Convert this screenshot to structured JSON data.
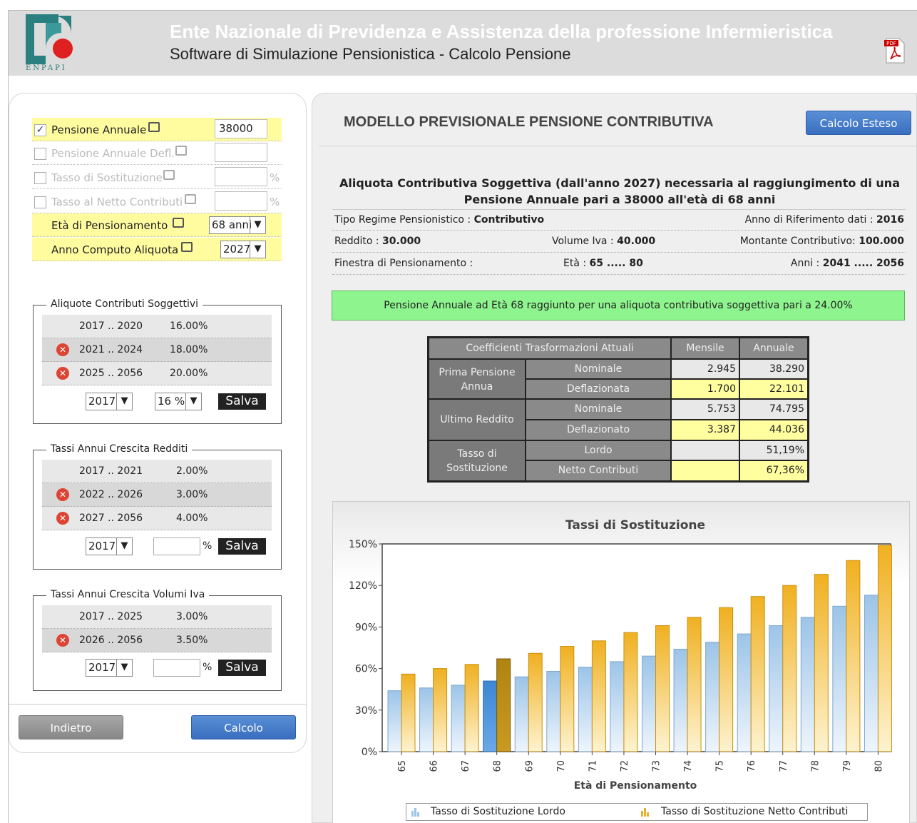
{
  "header": {
    "logo_text": "ENPAPI",
    "title": "Ente Nazionale di Previdenza e Assistenza della professione Infermieristica",
    "subtitle": "Software di Simulazione Pensionistica - Calcolo Pensione",
    "pdf_label": "PDF"
  },
  "form": {
    "pensione_annuale": {
      "label": "Pensione Annuale",
      "checked": true,
      "value": "38000"
    },
    "pensione_defl": {
      "label": "Pensione Annuale Defl."
    },
    "tasso_sost": {
      "label": "Tasso di Sostituzione",
      "unit": "%"
    },
    "tasso_netto": {
      "label": "Tasso al Netto Contributi",
      "unit": "%"
    },
    "eta_pens": {
      "label": "Età di Pensionamento",
      "value": "68 anni"
    },
    "anno_computo": {
      "label": "Anno Computo Aliquota",
      "value": "2027"
    }
  },
  "aliquote": {
    "legend": "Aliquote Contributi Soggettivi",
    "rows": [
      {
        "range": "2017 .. 2020",
        "value": "16.00%"
      },
      {
        "range": "2021 .. 2024",
        "value": "18.00%"
      },
      {
        "range": "2025 .. 2056",
        "value": "20.00%"
      }
    ],
    "year_sel": "2017",
    "pct_sel": "16 %",
    "save": "Salva"
  },
  "redditi": {
    "legend": "Tassi Annui Crescita Redditi",
    "rows": [
      {
        "range": "2017 .. 2021",
        "value": "2.00%"
      },
      {
        "range": "2022 .. 2026",
        "value": "3.00%"
      },
      {
        "range": "2027 .. 2056",
        "value": "4.00%"
      }
    ],
    "year_sel": "2017",
    "unit": "%",
    "save": "Salva"
  },
  "iva": {
    "legend": "Tassi Annui Crescita Volumi Iva",
    "rows": [
      {
        "range": "2017 .. 2025",
        "value": "3.00%"
      },
      {
        "range": "2026 .. 2056",
        "value": "3.50%"
      }
    ],
    "year_sel": "2017",
    "unit": "%",
    "save": "Salva"
  },
  "buttons": {
    "back": "Indietro",
    "calc": "Calcolo",
    "extended": "Calcolo Esteso"
  },
  "right": {
    "title": "MODELLO PREVISIONALE PENSIONE CONTRIBUTIVA",
    "info_title": "Aliquota Contributiva Soggettiva (dall'anno 2027) necessaria al raggiungimento di una Pensione Annuale pari a 38000 all'età di 68 anni",
    "regime_label": "Tipo Regime Pensionistico : ",
    "regime_value": "Contributivo",
    "anno_rif_label": "Anno di Riferimento dati : ",
    "anno_rif_value": "2016",
    "reddito_label": "Reddito : ",
    "reddito_value": "30.000",
    "iva_label": "Volume Iva : ",
    "iva_value": "40.000",
    "montante_label": "Montante Contributivo: ",
    "montante_value": "100.000",
    "finestra_label": "Finestra di Pensionamento :",
    "eta_label": "Età : ",
    "eta_value": "65 ..... 80",
    "anni_label": "Anni : ",
    "anni_value": "2041 ..... 2056",
    "green_msg": "Pensione Annuale ad Età 68 raggiunto per una aliquota contributiva soggettiva pari a 24.00%"
  },
  "coef": {
    "h1": "Coefficienti Trasformazioni Attuali",
    "h2": "Mensile",
    "h3": "Annuale",
    "g1": "Prima Pensione Annua",
    "g2": "Ultimo Reddito",
    "g3": "Tasso di Sostituzione",
    "nominale": "Nominale",
    "deflazionata": "Deflazionata",
    "deflazionato": "Deflazionato",
    "lordo": "Lordo",
    "netto": "Netto Contributi",
    "pp_nom_m": "2.945",
    "pp_nom_a": "38.290",
    "pp_def_m": "1.700",
    "pp_def_a": "22.101",
    "ur_nom_m": "5.753",
    "ur_nom_a": "74.795",
    "ur_def_m": "3.387",
    "ur_def_a": "44.036",
    "ts_lordo_a": "51,19%",
    "ts_netto_a": "67,36%"
  },
  "chart_data": {
    "type": "bar",
    "title": "Tassi di Sostituzione",
    "xlabel": "Età di Pensionamento",
    "ylabel": "",
    "categories": [
      "65",
      "66",
      "67",
      "68",
      "69",
      "70",
      "71",
      "72",
      "73",
      "74",
      "75",
      "76",
      "77",
      "78",
      "79",
      "80"
    ],
    "series": [
      {
        "name": "Tasso di Sostituzione Lordo",
        "values": [
          44,
          46,
          48,
          51,
          54,
          58,
          61,
          65,
          69,
          74,
          79,
          85,
          91,
          97,
          105,
          113
        ]
      },
      {
        "name": "Tasso di Sostituzione Netto Contributi",
        "values": [
          56,
          60,
          63,
          67,
          71,
          76,
          80,
          86,
          91,
          97,
          104,
          112,
          120,
          128,
          138,
          149
        ]
      }
    ],
    "highlight_category": "68",
    "ylim": [
      0,
      150
    ],
    "yticks": [
      "0%",
      "30%",
      "60%",
      "90%",
      "120%",
      "150%"
    ],
    "grid": false,
    "legend_position": "bottom",
    "colors": {
      "lordo": "#bcd8f0",
      "netto": "#f2c14e",
      "lordo_hl": "#3d86d4",
      "netto_hl": "#b08412"
    }
  }
}
